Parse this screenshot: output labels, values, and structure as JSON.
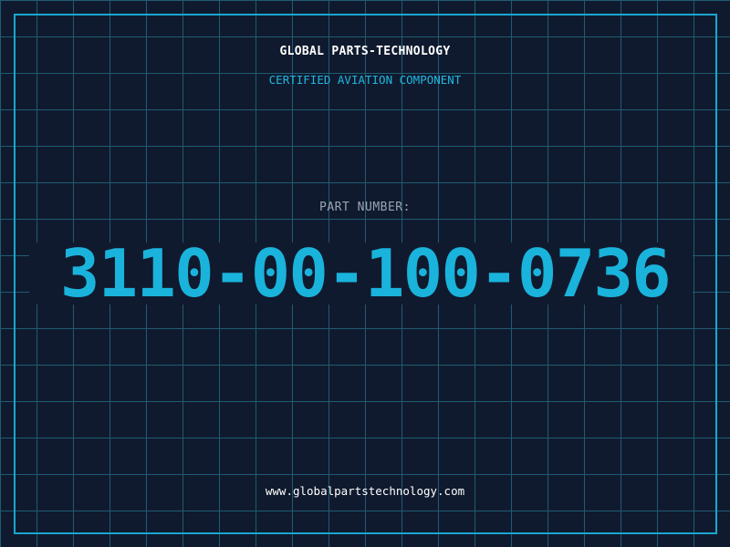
{
  "company": {
    "name": "GLOBAL PARTS-TECHNOLOGY",
    "tagline": "CERTIFIED AVIATION COMPONENT"
  },
  "part": {
    "label": "PART NUMBER:",
    "number": "3110-00-100-0736"
  },
  "footer": {
    "website": "www.globalpartstechnology.com"
  },
  "colors": {
    "background": "#101a2e",
    "grid": "#1e5c72",
    "accent": "#19a7cf",
    "text": "#ffffff",
    "muted": "#9aa5b4"
  }
}
